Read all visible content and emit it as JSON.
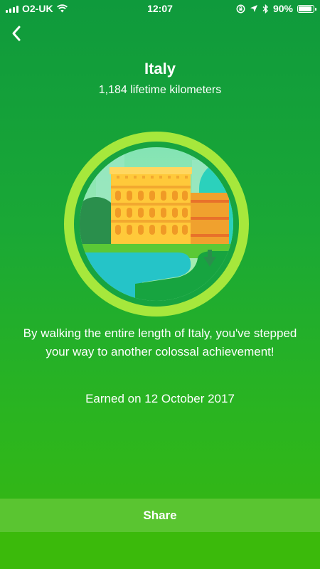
{
  "status_bar": {
    "carrier": "O2-UK",
    "time": "12:07",
    "battery_percent": "90%",
    "battery_level": 0.9,
    "icons": [
      "signal-icon",
      "wifi-icon",
      "orientation-lock-icon",
      "location-icon",
      "bluetooth-icon",
      "battery-icon"
    ]
  },
  "nav": {
    "back_icon": "chevron-left-icon"
  },
  "badge": {
    "title": "Italy",
    "subtitle": "1,184 lifetime kilometers",
    "image": "colosseum-badge"
  },
  "description": "By walking the entire length of Italy, you've stepped your way to another colossal achievement!",
  "earned": "Earned on 12 October 2017",
  "share": {
    "label": "Share"
  },
  "colors": {
    "background_top": "#0f9a3c",
    "background_bottom": "#39b80f",
    "share_bar": "#5ac531",
    "badge_ring": "#a6e83c"
  }
}
